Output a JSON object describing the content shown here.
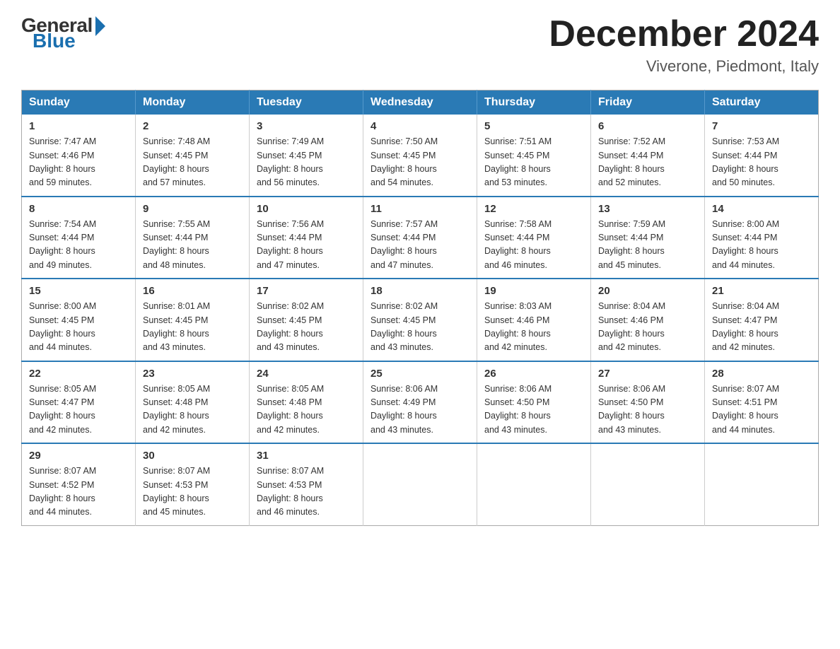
{
  "header": {
    "logo": {
      "general": "General",
      "blue": "Blue"
    },
    "title": "December 2024",
    "location": "Viverone, Piedmont, Italy"
  },
  "weekdays": [
    "Sunday",
    "Monday",
    "Tuesday",
    "Wednesday",
    "Thursday",
    "Friday",
    "Saturday"
  ],
  "weeks": [
    [
      {
        "day": "1",
        "sunrise": "7:47 AM",
        "sunset": "4:46 PM",
        "daylight": "8 hours and 59 minutes."
      },
      {
        "day": "2",
        "sunrise": "7:48 AM",
        "sunset": "4:45 PM",
        "daylight": "8 hours and 57 minutes."
      },
      {
        "day": "3",
        "sunrise": "7:49 AM",
        "sunset": "4:45 PM",
        "daylight": "8 hours and 56 minutes."
      },
      {
        "day": "4",
        "sunrise": "7:50 AM",
        "sunset": "4:45 PM",
        "daylight": "8 hours and 54 minutes."
      },
      {
        "day": "5",
        "sunrise": "7:51 AM",
        "sunset": "4:45 PM",
        "daylight": "8 hours and 53 minutes."
      },
      {
        "day": "6",
        "sunrise": "7:52 AM",
        "sunset": "4:44 PM",
        "daylight": "8 hours and 52 minutes."
      },
      {
        "day": "7",
        "sunrise": "7:53 AM",
        "sunset": "4:44 PM",
        "daylight": "8 hours and 50 minutes."
      }
    ],
    [
      {
        "day": "8",
        "sunrise": "7:54 AM",
        "sunset": "4:44 PM",
        "daylight": "8 hours and 49 minutes."
      },
      {
        "day": "9",
        "sunrise": "7:55 AM",
        "sunset": "4:44 PM",
        "daylight": "8 hours and 48 minutes."
      },
      {
        "day": "10",
        "sunrise": "7:56 AM",
        "sunset": "4:44 PM",
        "daylight": "8 hours and 47 minutes."
      },
      {
        "day": "11",
        "sunrise": "7:57 AM",
        "sunset": "4:44 PM",
        "daylight": "8 hours and 47 minutes."
      },
      {
        "day": "12",
        "sunrise": "7:58 AM",
        "sunset": "4:44 PM",
        "daylight": "8 hours and 46 minutes."
      },
      {
        "day": "13",
        "sunrise": "7:59 AM",
        "sunset": "4:44 PM",
        "daylight": "8 hours and 45 minutes."
      },
      {
        "day": "14",
        "sunrise": "8:00 AM",
        "sunset": "4:44 PM",
        "daylight": "8 hours and 44 minutes."
      }
    ],
    [
      {
        "day": "15",
        "sunrise": "8:00 AM",
        "sunset": "4:45 PM",
        "daylight": "8 hours and 44 minutes."
      },
      {
        "day": "16",
        "sunrise": "8:01 AM",
        "sunset": "4:45 PM",
        "daylight": "8 hours and 43 minutes."
      },
      {
        "day": "17",
        "sunrise": "8:02 AM",
        "sunset": "4:45 PM",
        "daylight": "8 hours and 43 minutes."
      },
      {
        "day": "18",
        "sunrise": "8:02 AM",
        "sunset": "4:45 PM",
        "daylight": "8 hours and 43 minutes."
      },
      {
        "day": "19",
        "sunrise": "8:03 AM",
        "sunset": "4:46 PM",
        "daylight": "8 hours and 42 minutes."
      },
      {
        "day": "20",
        "sunrise": "8:04 AM",
        "sunset": "4:46 PM",
        "daylight": "8 hours and 42 minutes."
      },
      {
        "day": "21",
        "sunrise": "8:04 AM",
        "sunset": "4:47 PM",
        "daylight": "8 hours and 42 minutes."
      }
    ],
    [
      {
        "day": "22",
        "sunrise": "8:05 AM",
        "sunset": "4:47 PM",
        "daylight": "8 hours and 42 minutes."
      },
      {
        "day": "23",
        "sunrise": "8:05 AM",
        "sunset": "4:48 PM",
        "daylight": "8 hours and 42 minutes."
      },
      {
        "day": "24",
        "sunrise": "8:05 AM",
        "sunset": "4:48 PM",
        "daylight": "8 hours and 42 minutes."
      },
      {
        "day": "25",
        "sunrise": "8:06 AM",
        "sunset": "4:49 PM",
        "daylight": "8 hours and 43 minutes."
      },
      {
        "day": "26",
        "sunrise": "8:06 AM",
        "sunset": "4:50 PM",
        "daylight": "8 hours and 43 minutes."
      },
      {
        "day": "27",
        "sunrise": "8:06 AM",
        "sunset": "4:50 PM",
        "daylight": "8 hours and 43 minutes."
      },
      {
        "day": "28",
        "sunrise": "8:07 AM",
        "sunset": "4:51 PM",
        "daylight": "8 hours and 44 minutes."
      }
    ],
    [
      {
        "day": "29",
        "sunrise": "8:07 AM",
        "sunset": "4:52 PM",
        "daylight": "8 hours and 44 minutes."
      },
      {
        "day": "30",
        "sunrise": "8:07 AM",
        "sunset": "4:53 PM",
        "daylight": "8 hours and 45 minutes."
      },
      {
        "day": "31",
        "sunrise": "8:07 AM",
        "sunset": "4:53 PM",
        "daylight": "8 hours and 46 minutes."
      },
      null,
      null,
      null,
      null
    ]
  ],
  "labels": {
    "sunrise": "Sunrise:",
    "sunset": "Sunset:",
    "daylight": "Daylight:"
  }
}
